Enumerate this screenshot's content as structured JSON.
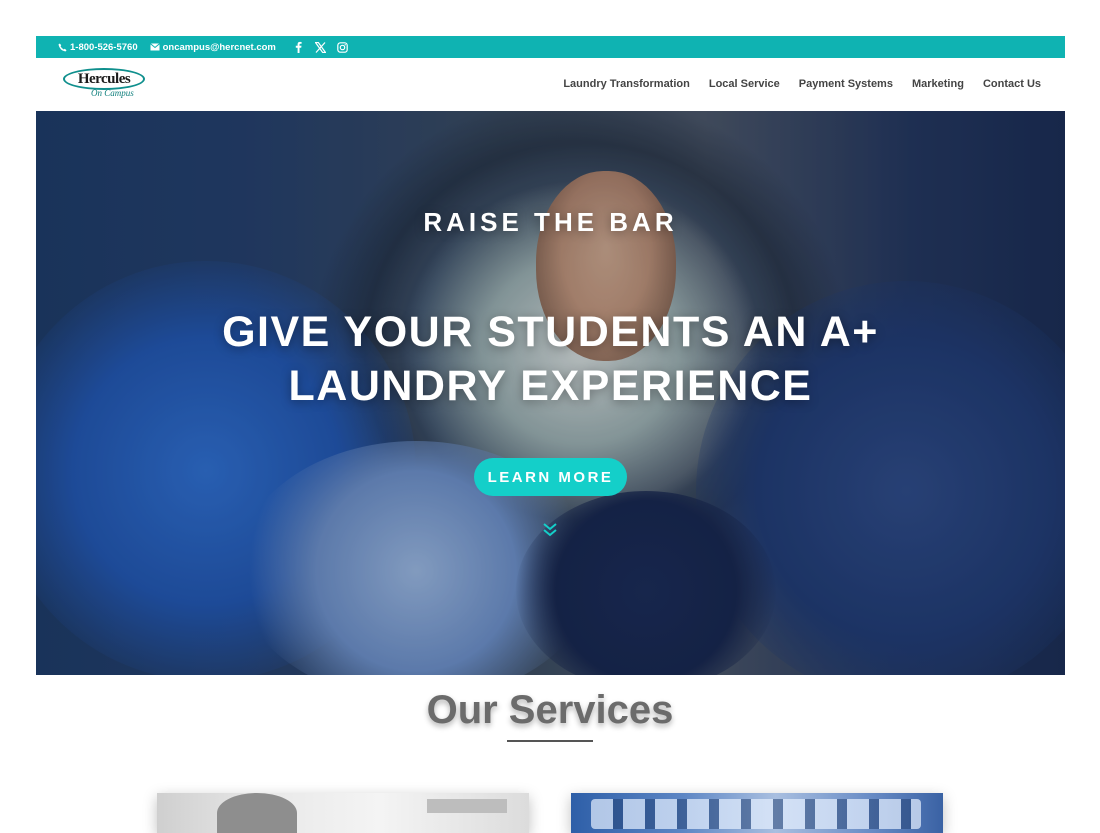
{
  "topbar": {
    "phone": "1-800-526-5760",
    "email": "oncampus@hercnet.com",
    "social_icons": [
      "facebook-icon",
      "x-icon",
      "instagram-icon"
    ]
  },
  "brand": {
    "logo_main": "Hercules",
    "logo_sub": "On Campus"
  },
  "nav": {
    "items": [
      "Laundry Transformation",
      "Local Service",
      "Payment Systems",
      "Marketing",
      "Contact Us"
    ]
  },
  "hero": {
    "kicker": "RAISE THE BAR",
    "headline_line1": "GIVE YOUR STUDENTS AN A+",
    "headline_line2": "LAUNDRY EXPERIENCE",
    "cta_label": "LEARN MORE"
  },
  "services": {
    "title": "Our Services"
  },
  "colors": {
    "accent": "#0fb3b2",
    "cta": "#14cfc9",
    "nav_text": "#444444"
  }
}
